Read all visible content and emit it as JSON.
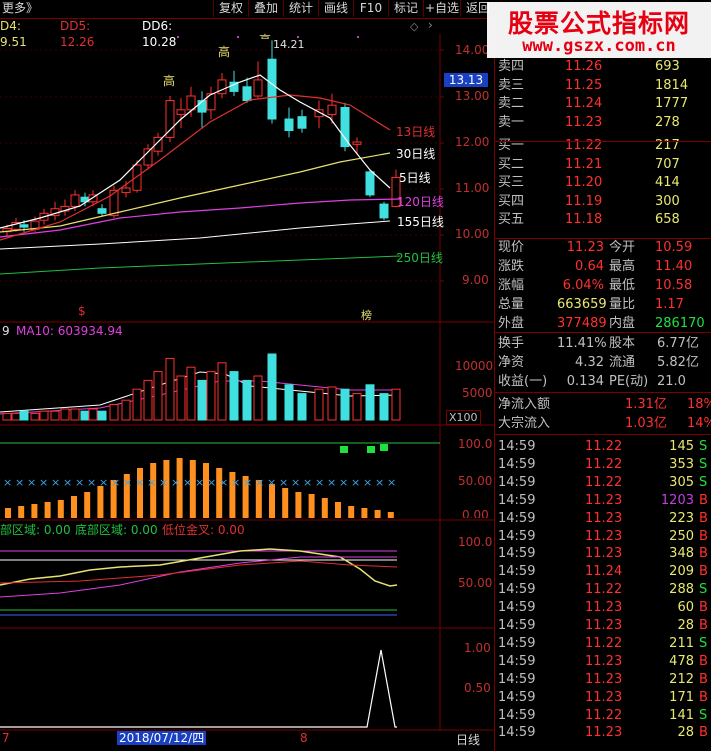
{
  "toolbar": {
    "title": "更多》",
    "buttons": [
      "复权",
      "叠加",
      "统计",
      "画线",
      "F10",
      "标记",
      "+自选",
      "返回"
    ]
  },
  "ma_row": {
    "ma4": "D4: 9.51",
    "ma5": "DD5: 12.26",
    "ma6": "DD6: 10.28"
  },
  "watermark": {
    "line1": "股票公式指标网",
    "line2": "www.gszx.com.cn"
  },
  "main_chart": {
    "y_labels": [
      "14.00",
      "13.00",
      "12.00",
      "11.00",
      "10.00",
      "9.00"
    ],
    "current_price_tag": "13.13",
    "peak_label": "14.21",
    "high_labels": [
      "高",
      "高",
      "高"
    ],
    "ma_labels": [
      "13日线",
      "30日线",
      "5日线",
      "120日线",
      "155日线",
      "250日线"
    ],
    "ma_colors": {
      "ma5": "#ffffff",
      "ma13": "#e03030",
      "ma30": "#e8e070",
      "ma120": "#e040e0",
      "ma155": "#ffffff",
      "ma250": "#20c040"
    },
    "bottom_marks": [
      "$",
      "榜"
    ]
  },
  "volume_pane": {
    "header_num": "9",
    "header_ma10": "MA10: 603934.94",
    "y_labels": [
      "10000",
      "5000"
    ],
    "unit": "X100"
  },
  "kdj_pane": {
    "y_labels": [
      "100.0",
      "50.00",
      "0.00"
    ]
  },
  "region_pane": {
    "label1": "部区域: 0.00",
    "label2": "底部区域: 0.00",
    "label3": "低位金叉: 0.00",
    "y_labels": [
      "100.0",
      "50.00"
    ]
  },
  "signal_pane": {
    "y_labels": [
      "1.00",
      "0.50"
    ]
  },
  "date_axis": {
    "left_mark": "7",
    "date": "2018/07/12/四",
    "mid_mark": "8",
    "period_button": "日线"
  },
  "order_book": [
    {
      "label": "卖四",
      "price": "11.26",
      "vol": "693"
    },
    {
      "label": "卖三",
      "price": "11.25",
      "vol": "1814"
    },
    {
      "label": "卖二",
      "price": "11.24",
      "vol": "1777"
    },
    {
      "label": "卖一",
      "price": "11.23",
      "vol": "278"
    },
    {
      "label": "买一",
      "price": "11.22",
      "vol": "217"
    },
    {
      "label": "买二",
      "price": "11.21",
      "vol": "707"
    },
    {
      "label": "买三",
      "price": "11.20",
      "vol": "414"
    },
    {
      "label": "买四",
      "price": "11.19",
      "vol": "300"
    },
    {
      "label": "买五",
      "price": "11.18",
      "vol": "658"
    }
  ],
  "quote": [
    {
      "l1": "现价",
      "v1": "11.23",
      "l2": "今开",
      "v2": "10.59"
    },
    {
      "l1": "涨跌",
      "v1": "0.64",
      "l2": "最高",
      "v2": "11.40"
    },
    {
      "l1": "涨幅",
      "v1": "6.04%",
      "l2": "最低",
      "v2": "10.58"
    },
    {
      "l1": "总量",
      "v1": "663659",
      "l2": "量比",
      "v2": "1.17"
    },
    {
      "l1": "外盘",
      "v1": "377489",
      "l2": "内盘",
      "v2": "286170"
    }
  ],
  "fund": [
    {
      "l1": "换手",
      "v1": "11.41%",
      "l2": "股本",
      "v2": "6.77亿"
    },
    {
      "l1": "净资",
      "v1": "4.32",
      "l2": "流通",
      "v2": "5.82亿"
    },
    {
      "l1": "收益(一)",
      "v1": "0.134",
      "l2": "PE(动)",
      "v2": "21.0"
    }
  ],
  "flow": [
    {
      "label": "净流入额",
      "value": "1.31亿",
      "pct": "18%"
    },
    {
      "label": "大宗流入",
      "value": "1.03亿",
      "pct": "14%"
    }
  ],
  "trades": [
    {
      "time": "14:59",
      "price": "11.22",
      "vol": "145",
      "side": "S"
    },
    {
      "time": "14:59",
      "price": "11.22",
      "vol": "353",
      "side": "S"
    },
    {
      "time": "14:59",
      "price": "11.22",
      "vol": "305",
      "side": "S"
    },
    {
      "time": "14:59",
      "price": "11.23",
      "vol": "1203",
      "side": "B"
    },
    {
      "time": "14:59",
      "price": "11.23",
      "vol": "223",
      "side": "B"
    },
    {
      "time": "14:59",
      "price": "11.23",
      "vol": "250",
      "side": "B"
    },
    {
      "time": "14:59",
      "price": "11.23",
      "vol": "348",
      "side": "B"
    },
    {
      "time": "14:59",
      "price": "11.24",
      "vol": "209",
      "side": "B"
    },
    {
      "time": "14:59",
      "price": "11.22",
      "vol": "288",
      "side": "S"
    },
    {
      "time": "14:59",
      "price": "11.23",
      "vol": "60",
      "side": "B"
    },
    {
      "time": "14:59",
      "price": "11.23",
      "vol": "28",
      "side": "B"
    },
    {
      "time": "14:59",
      "price": "11.22",
      "vol": "211",
      "side": "S"
    },
    {
      "time": "14:59",
      "price": "11.23",
      "vol": "478",
      "side": "B"
    },
    {
      "time": "14:59",
      "price": "11.23",
      "vol": "212",
      "side": "B"
    },
    {
      "time": "14:59",
      "price": "11.23",
      "vol": "171",
      "side": "B"
    },
    {
      "time": "14:59",
      "price": "11.22",
      "vol": "141",
      "side": "S"
    },
    {
      "time": "14:59",
      "price": "11.23",
      "vol": "28",
      "side": "B"
    }
  ]
}
